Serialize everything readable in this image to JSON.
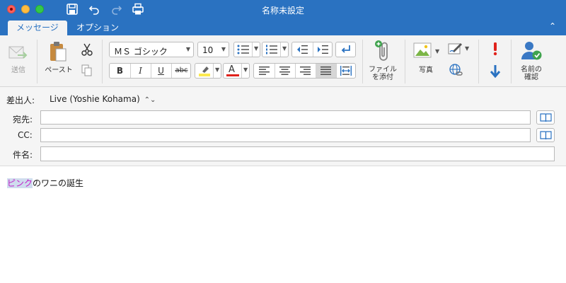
{
  "window": {
    "title": "名称未設定"
  },
  "tabs": [
    {
      "label": "メッセージ"
    },
    {
      "label": "オプション"
    }
  ],
  "ribbon": {
    "send_label": "送信",
    "paste_label": "ペースト",
    "font_name": "ＭＳ ゴシック",
    "font_size": "10",
    "attach_label_line1": "ファイル",
    "attach_label_line2": "を添付",
    "photo_label": "写真",
    "check_names_line1": "名前の",
    "check_names_line2": "確認",
    "bold": "B",
    "italic": "I",
    "underline": "U",
    "strike": "abc",
    "font_color": "A"
  },
  "header": {
    "from_label": "差出人:",
    "from_value": "Live (Yoshie Kohama)",
    "to_label": "宛先:",
    "to_value": "",
    "cc_label": "CC:",
    "cc_value": "",
    "subject_label": "件名:",
    "subject_value": ""
  },
  "body": {
    "highlighted": "ピンク",
    "rest": "のワニの誕生"
  },
  "colors": {
    "title_bar": "#2a72c1",
    "highlight_fill": "#fce94f",
    "font_color_bar": "#e0221b",
    "accent": "#2a72c1"
  }
}
